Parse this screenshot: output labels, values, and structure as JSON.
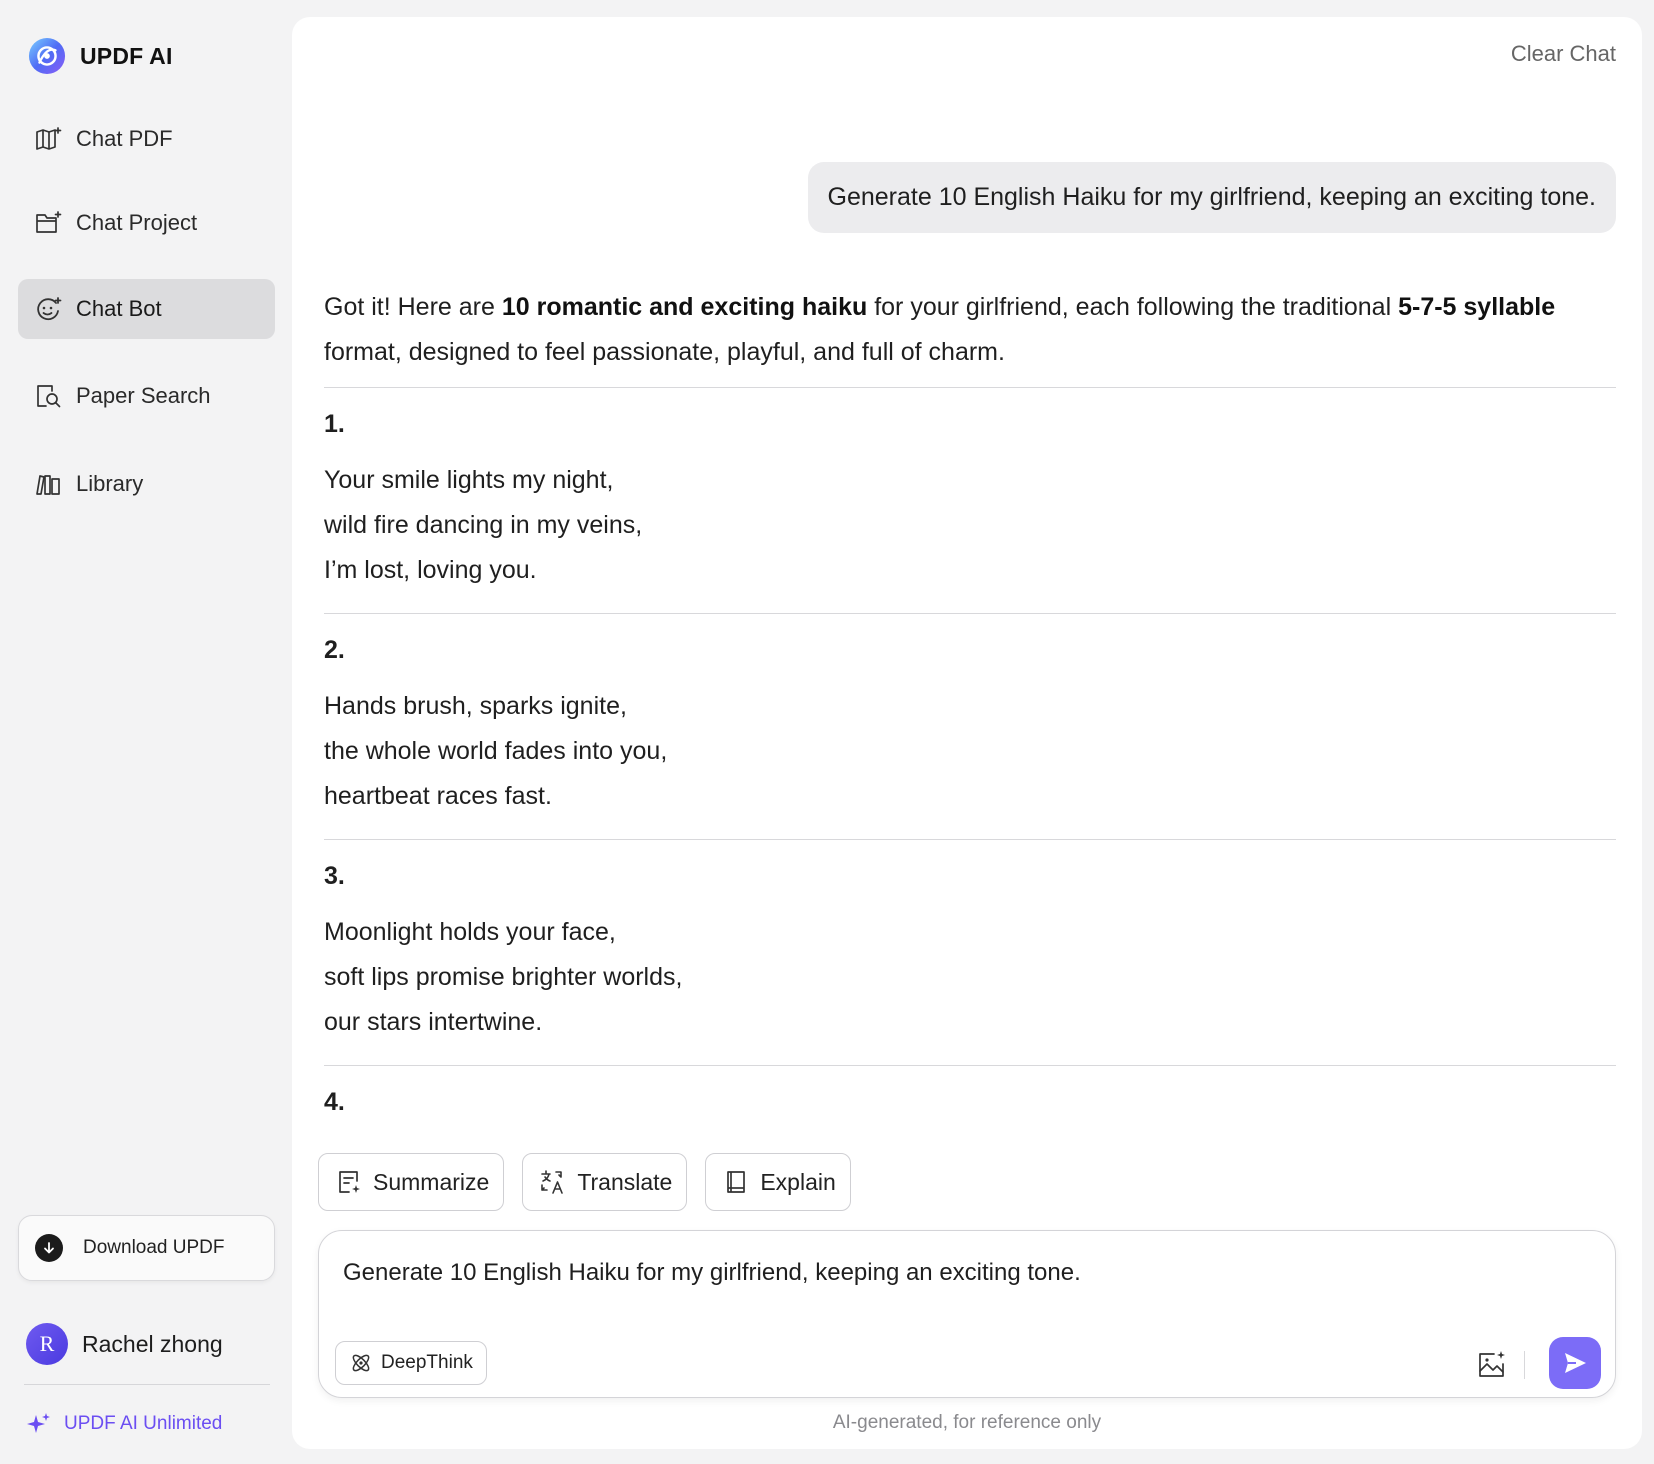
{
  "brand": {
    "name": "UPDF AI",
    "accent": "#4f6cf5"
  },
  "sidebar": {
    "items": [
      {
        "label": "Chat PDF",
        "icon": "chat-pdf-icon",
        "active": false
      },
      {
        "label": "Chat Project",
        "icon": "chat-project-icon",
        "active": false
      },
      {
        "label": "Chat Bot",
        "icon": "chat-bot-icon",
        "active": true
      },
      {
        "label": "Paper Search",
        "icon": "paper-search-icon",
        "active": false
      },
      {
        "label": "Library",
        "icon": "library-icon",
        "active": false
      }
    ],
    "download_label": "Download UPDF",
    "user": {
      "initial": "R",
      "name": "Rachel zhong"
    },
    "unlimited_label": "UPDF AI Unlimited",
    "unlimited_color": "#6b4ef2"
  },
  "main": {
    "clear_chat": "Clear Chat",
    "user_message": "Generate 10 English Haiku for my girlfriend, keeping an exciting tone.",
    "answer": {
      "intro_1": "Got it! Here are ",
      "intro_bold_1": "10 romantic and exciting haiku",
      "intro_2": " for your girlfriend, each following the traditional ",
      "intro_bold_2": "5-7-5 syllable",
      "intro_3": " format, designed to feel passionate, playful, and full of charm.",
      "haiku": [
        {
          "num": "1.",
          "lines": [
            "Your smile lights my night,",
            "wild fire dancing in my veins,",
            "I’m lost, loving you."
          ]
        },
        {
          "num": "2.",
          "lines": [
            "Hands brush, sparks ignite,",
            "the whole world fades into you,",
            "heartbeat races fast."
          ]
        },
        {
          "num": "3.",
          "lines": [
            "Moonlight holds your face,",
            "soft lips promise brighter worlds,",
            "our stars intertwine."
          ]
        },
        {
          "num": "4.",
          "lines": []
        }
      ]
    },
    "quick_actions": [
      {
        "label": "Summarize",
        "icon": "summarize-icon"
      },
      {
        "label": "Translate",
        "icon": "translate-icon"
      },
      {
        "label": "Explain",
        "icon": "explain-icon"
      }
    ],
    "composer": {
      "value": "Generate 10 English Haiku for my girlfriend, keeping an exciting tone.",
      "deepthink_label": "DeepThink",
      "send_color": "#7c6cf7"
    },
    "footnote": "AI-generated, for reference only"
  }
}
